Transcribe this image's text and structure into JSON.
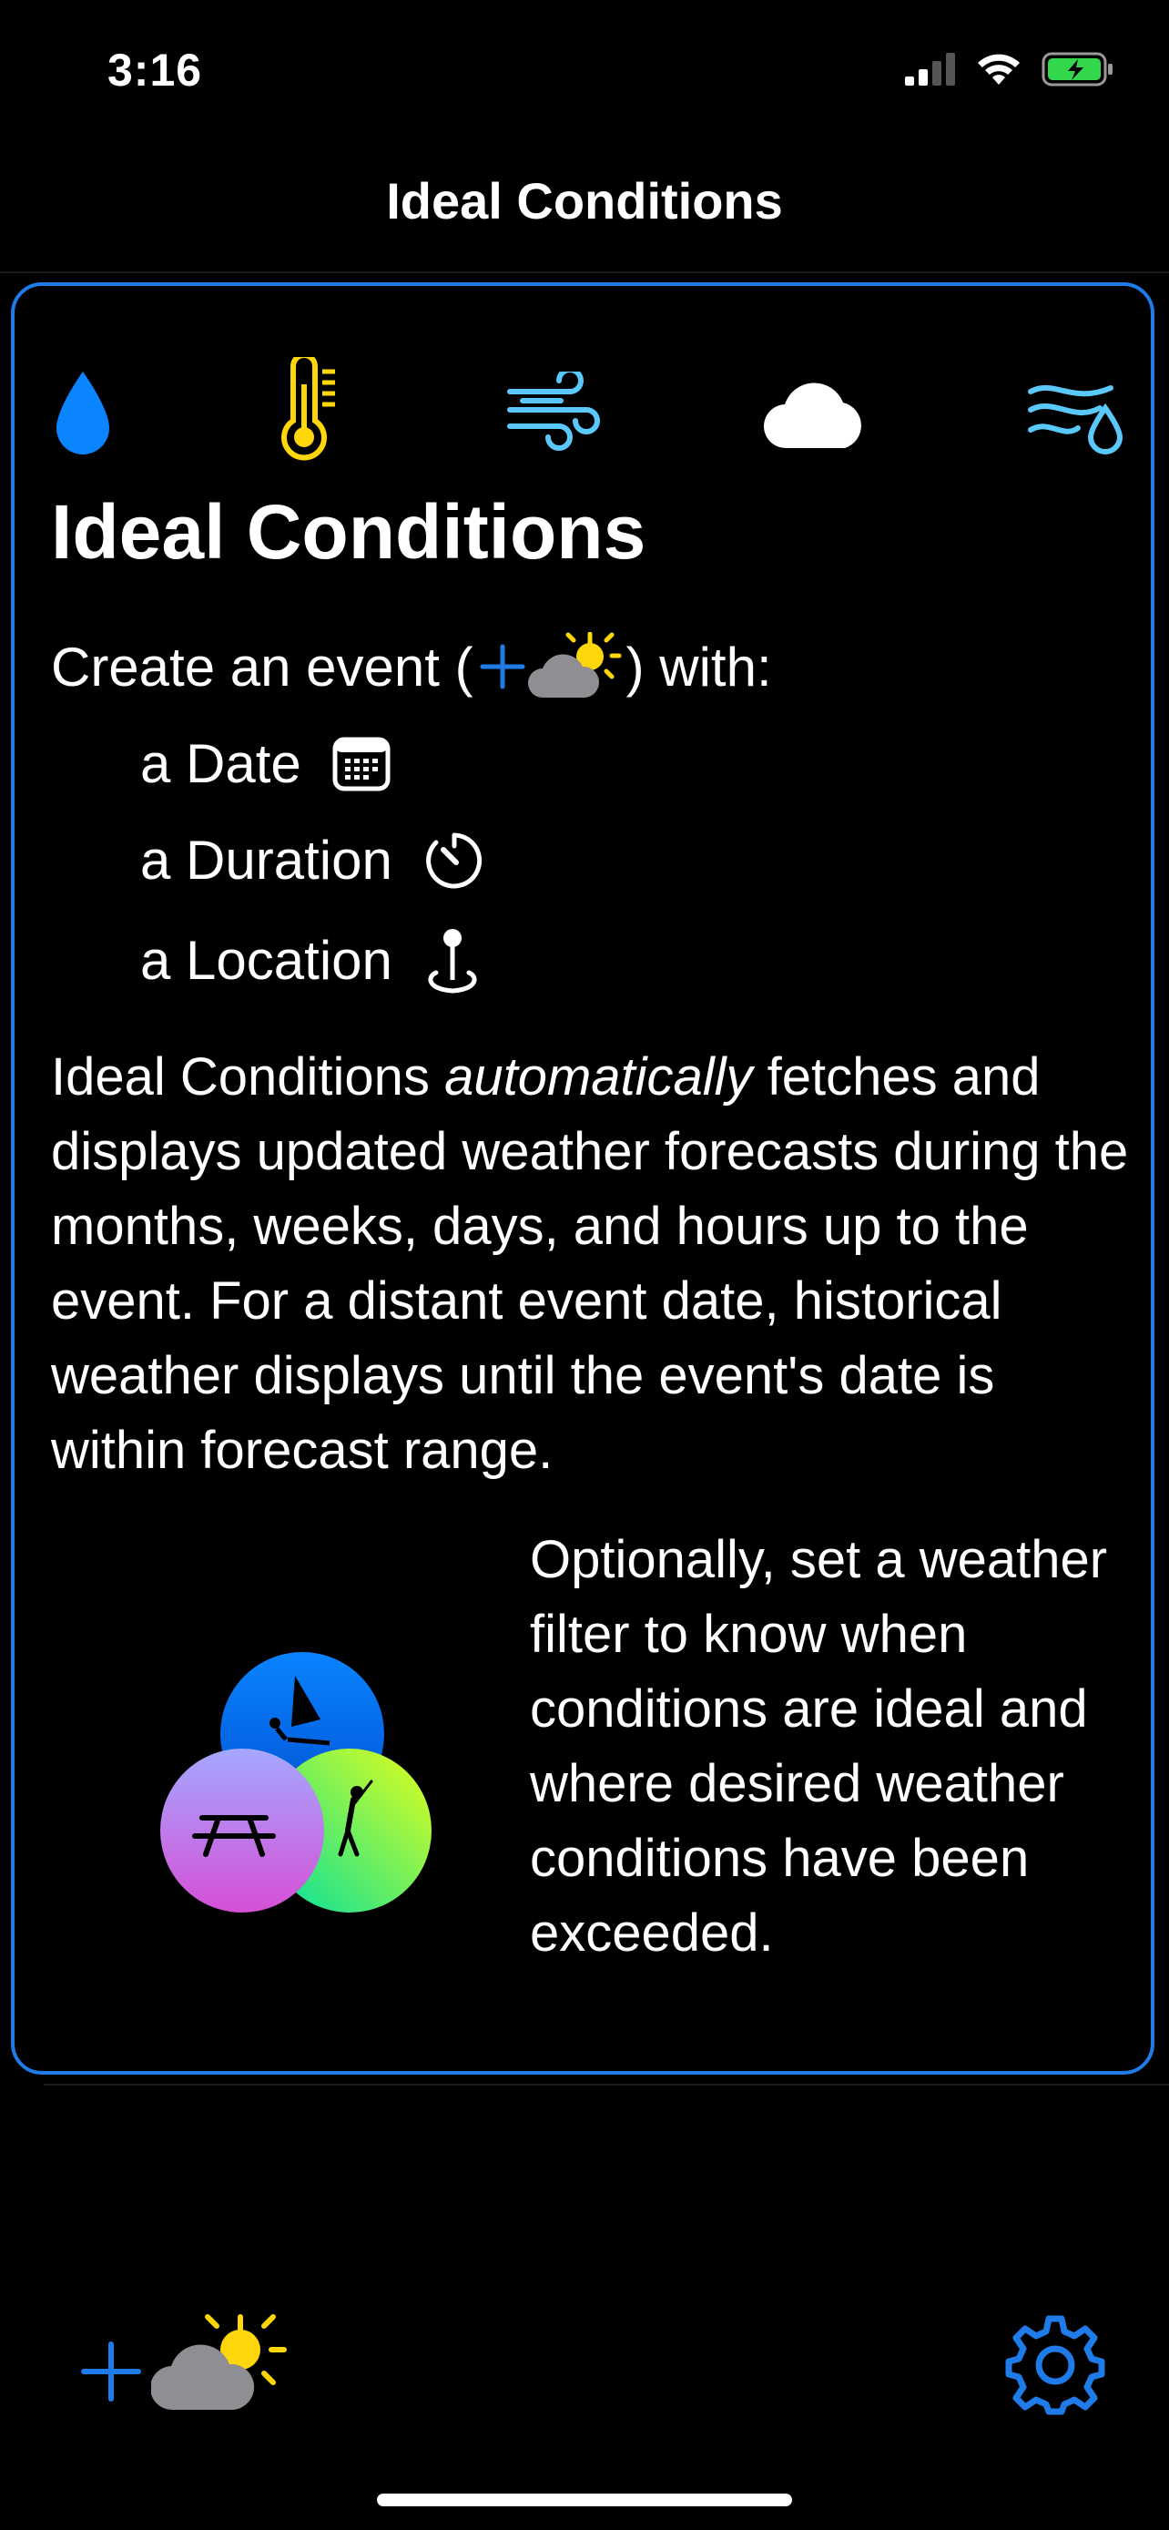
{
  "status_bar": {
    "time": "3:16"
  },
  "nav": {
    "title": "Ideal Conditions"
  },
  "card": {
    "icons": [
      "drop-icon",
      "thermometer-icon",
      "wind-icon",
      "cloud-icon",
      "wind-rain-icon"
    ],
    "title": "Ideal Conditions",
    "create_prefix": "Create an event (",
    "create_suffix": ") with:",
    "requirements": [
      {
        "label": "a Date",
        "icon": "calendar-icon"
      },
      {
        "label": "a Duration",
        "icon": "timer-icon"
      },
      {
        "label": "a Location",
        "icon": "location-pin-icon"
      }
    ],
    "description_part1": "Ideal Conditions ",
    "description_em": "automatically",
    "description_part2": " fetches and displays updated weather forecasts during the months, weeks, days, and hours up to the event. For a distant event date, historical weather displays until the event's date is within forecast range.",
    "filter_text": "Optionally, set a weather filter to know when conditions are ideal and where desired weather conditions have been exceeded."
  },
  "colors": {
    "accent": "#1f7be8",
    "drop": "#0a84ff",
    "thermometer": "#ffd60a",
    "wind": "#5ac8fa",
    "sun": "#ffd60a",
    "cloud_gray": "#8e8e93"
  }
}
